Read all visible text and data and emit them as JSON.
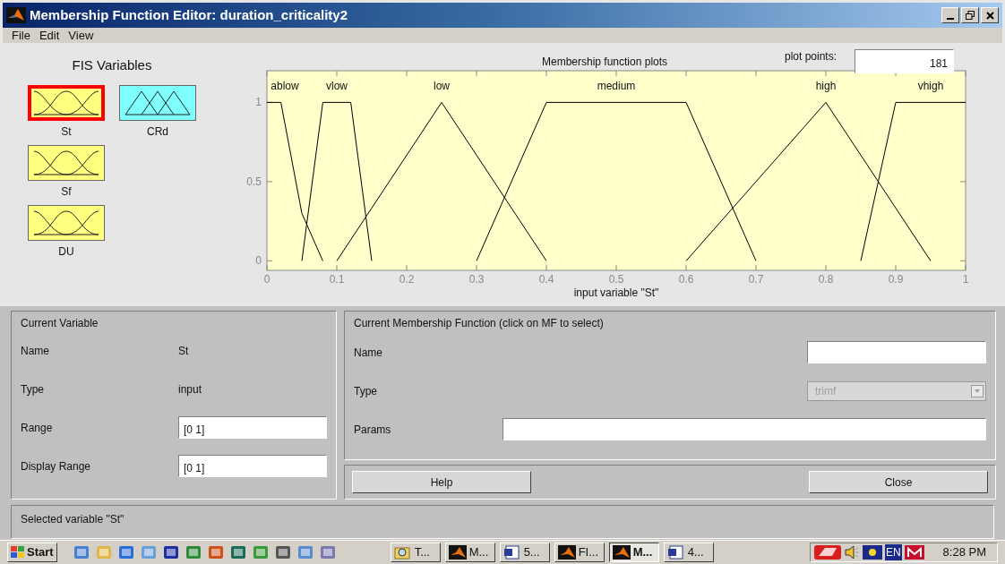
{
  "window": {
    "title": "Membership Function Editor: duration_criticality2"
  },
  "menu": [
    "File",
    "Edit",
    "View"
  ],
  "fis_variables": {
    "title": "FIS Variables",
    "items": [
      {
        "label": "St",
        "kind": "input",
        "selected": true
      },
      {
        "label": "CRd",
        "kind": "output",
        "selected": false
      },
      {
        "label": "Sf",
        "kind": "input",
        "selected": false
      },
      {
        "label": "DU",
        "kind": "input",
        "selected": false
      }
    ]
  },
  "plot": {
    "title": "Membership function plots",
    "plot_points_label": "plot points:",
    "plot_points_value": "181",
    "chart_data": {
      "type": "line",
      "xlabel": "input variable \"St\"",
      "x": [
        0,
        0.02,
        0.05,
        0.08,
        0.1,
        0.12,
        0.15,
        0.25,
        0.3,
        0.4,
        0.6,
        0.7,
        0.8,
        0.85,
        0.9,
        0.95,
        1
      ],
      "series": [
        {
          "name": "ablow",
          "color": "#000000",
          "values": [
            1,
            1,
            0.3,
            0,
            null,
            null,
            null,
            null,
            null,
            null,
            null,
            null,
            null,
            null,
            null,
            null,
            null
          ]
        },
        {
          "name": "vlow",
          "color": "#000000",
          "values": [
            null,
            null,
            0,
            1,
            1,
            1,
            0,
            null,
            null,
            null,
            null,
            null,
            null,
            null,
            null,
            null,
            null
          ]
        },
        {
          "name": "low",
          "color": "#000000",
          "values": [
            null,
            null,
            null,
            null,
            0,
            0.133,
            0.333,
            1,
            0.667,
            0,
            null,
            null,
            null,
            null,
            null,
            null,
            null
          ]
        },
        {
          "name": "medium",
          "color": "#000000",
          "values": [
            null,
            null,
            null,
            null,
            null,
            null,
            null,
            null,
            0,
            1,
            1,
            0,
            null,
            null,
            null,
            null,
            null
          ]
        },
        {
          "name": "high",
          "color": "#000000",
          "values": [
            null,
            null,
            null,
            null,
            null,
            null,
            null,
            null,
            null,
            null,
            0,
            0.5,
            1,
            0.667,
            0.333,
            0,
            null
          ]
        },
        {
          "name": "vhigh",
          "color": "#000000",
          "values": [
            null,
            null,
            null,
            null,
            null,
            null,
            null,
            null,
            null,
            null,
            null,
            null,
            null,
            0,
            1,
            1,
            1
          ]
        }
      ],
      "xlim": [
        0,
        1
      ],
      "ylim": [
        -0.06,
        1.2
      ],
      "xticks": [
        0,
        0.1,
        0.2,
        0.3,
        0.4,
        0.5,
        0.6,
        0.7,
        0.8,
        0.9,
        1
      ],
      "yticks": [
        0,
        0.5,
        1
      ]
    }
  },
  "current_variable": {
    "title": "Current Variable",
    "rows": [
      {
        "label": "Name",
        "value": "St",
        "kind": "text"
      },
      {
        "label": "Type",
        "value": "input",
        "kind": "text"
      },
      {
        "label": "Range",
        "value": "[0 1]",
        "kind": "field"
      },
      {
        "label": "Display Range",
        "value": "[0 1]",
        "kind": "field"
      }
    ]
  },
  "current_mf": {
    "title": "Current Membership Function (click on MF to select)",
    "rows": [
      {
        "label": "Name",
        "kind": "field"
      },
      {
        "label": "Type",
        "kind": "dropdown",
        "value": "trimf",
        "disabled": true
      },
      {
        "label": "Params",
        "kind": "wide_field"
      }
    ]
  },
  "buttons": [
    "Help",
    "Close"
  ],
  "status": "Selected variable \"St\"",
  "taskbar": {
    "start": "Start",
    "tasks": [
      {
        "label": "T...",
        "kind": "search",
        "selected": false
      },
      {
        "label": "M...",
        "kind": "app",
        "selected": false
      },
      {
        "label": "5...",
        "kind": "document",
        "selected": false
      },
      {
        "label": "FI...",
        "kind": "app",
        "selected": false
      },
      {
        "label": "M...",
        "kind": "app",
        "selected": true
      },
      {
        "label": "4...",
        "kind": "document",
        "selected": false
      }
    ],
    "language": "EN",
    "clock": "8:28 PM"
  }
}
